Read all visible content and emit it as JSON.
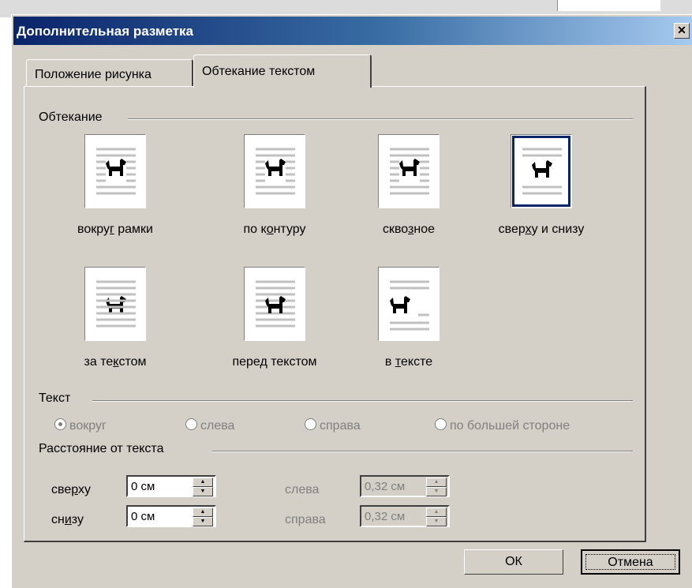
{
  "window": {
    "title": "Дополнительная разметка",
    "close_label": "✕"
  },
  "tabs": [
    {
      "label": "Положение рисунка",
      "active": false
    },
    {
      "label": "Обтекание текстом",
      "active": true
    }
  ],
  "wrapping": {
    "section_label": "Обтекание",
    "options": [
      {
        "id": "square",
        "label_pre": "вокру",
        "label_key": "г",
        "label_post": " рамки",
        "selected": false
      },
      {
        "id": "tight",
        "label_pre": "по к",
        "label_key": "о",
        "label_post": "нтуру",
        "selected": false
      },
      {
        "id": "through",
        "label_pre": "скво",
        "label_key": "з",
        "label_post": "ное",
        "selected": false
      },
      {
        "id": "top-bottom",
        "label_pre": "свер",
        "label_key": "х",
        "label_post": "у и снизу",
        "selected": true
      },
      {
        "id": "behind",
        "label_pre": "за те",
        "label_key": "к",
        "label_post": "стом",
        "selected": false
      },
      {
        "id": "in-front",
        "label_pre": "пере",
        "label_key": "д",
        "label_post": " текстом",
        "selected": false
      },
      {
        "id": "inline",
        "label_pre": "в ",
        "label_key": "т",
        "label_post": "ексте",
        "selected": false
      }
    ]
  },
  "text_section": {
    "label": "Текст",
    "radios": [
      {
        "label": "вокруг",
        "checked": true
      },
      {
        "label": "слева",
        "checked": false
      },
      {
        "label": "справа",
        "checked": false
      },
      {
        "label": "по большей стороне",
        "checked": false
      }
    ]
  },
  "distance": {
    "label": "Расстояние от текста",
    "top": {
      "label_pre": "све",
      "label_key": "р",
      "label_post": "ху",
      "value": "0 см"
    },
    "bottom": {
      "label_pre": "сн",
      "label_key": "и",
      "label_post": "зу",
      "value": "0 см"
    },
    "left": {
      "label": "слева",
      "value": "0,32 см"
    },
    "right": {
      "label": "справа",
      "value": "0,32 см"
    }
  },
  "buttons": {
    "ok": "ОК",
    "cancel": "Отмена"
  }
}
